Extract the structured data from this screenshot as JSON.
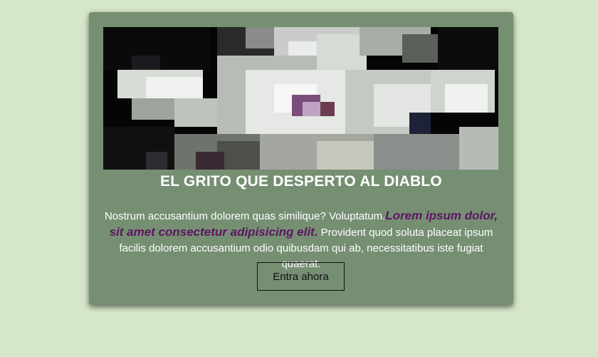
{
  "card": {
    "title": "EL GRITO QUE DESPERTO AL DIABLO",
    "description_before": "Nostrum accusantium dolorem quas similique? Voluptatum.",
    "description_highlight": "Lorem ipsum dolor, sit amet consectetur adipisicing elit.",
    "description_after": " Provident quod soluta placeat ipsum facilis dolorem accusantium odio quibusdam qui ab, necessitatibus iste fugiat quaerat.",
    "button_label": "Entra ahora"
  },
  "colors": {
    "page_background": "#d6e6c9",
    "card_background": "#768f73",
    "highlight_text": "#5d1463"
  }
}
